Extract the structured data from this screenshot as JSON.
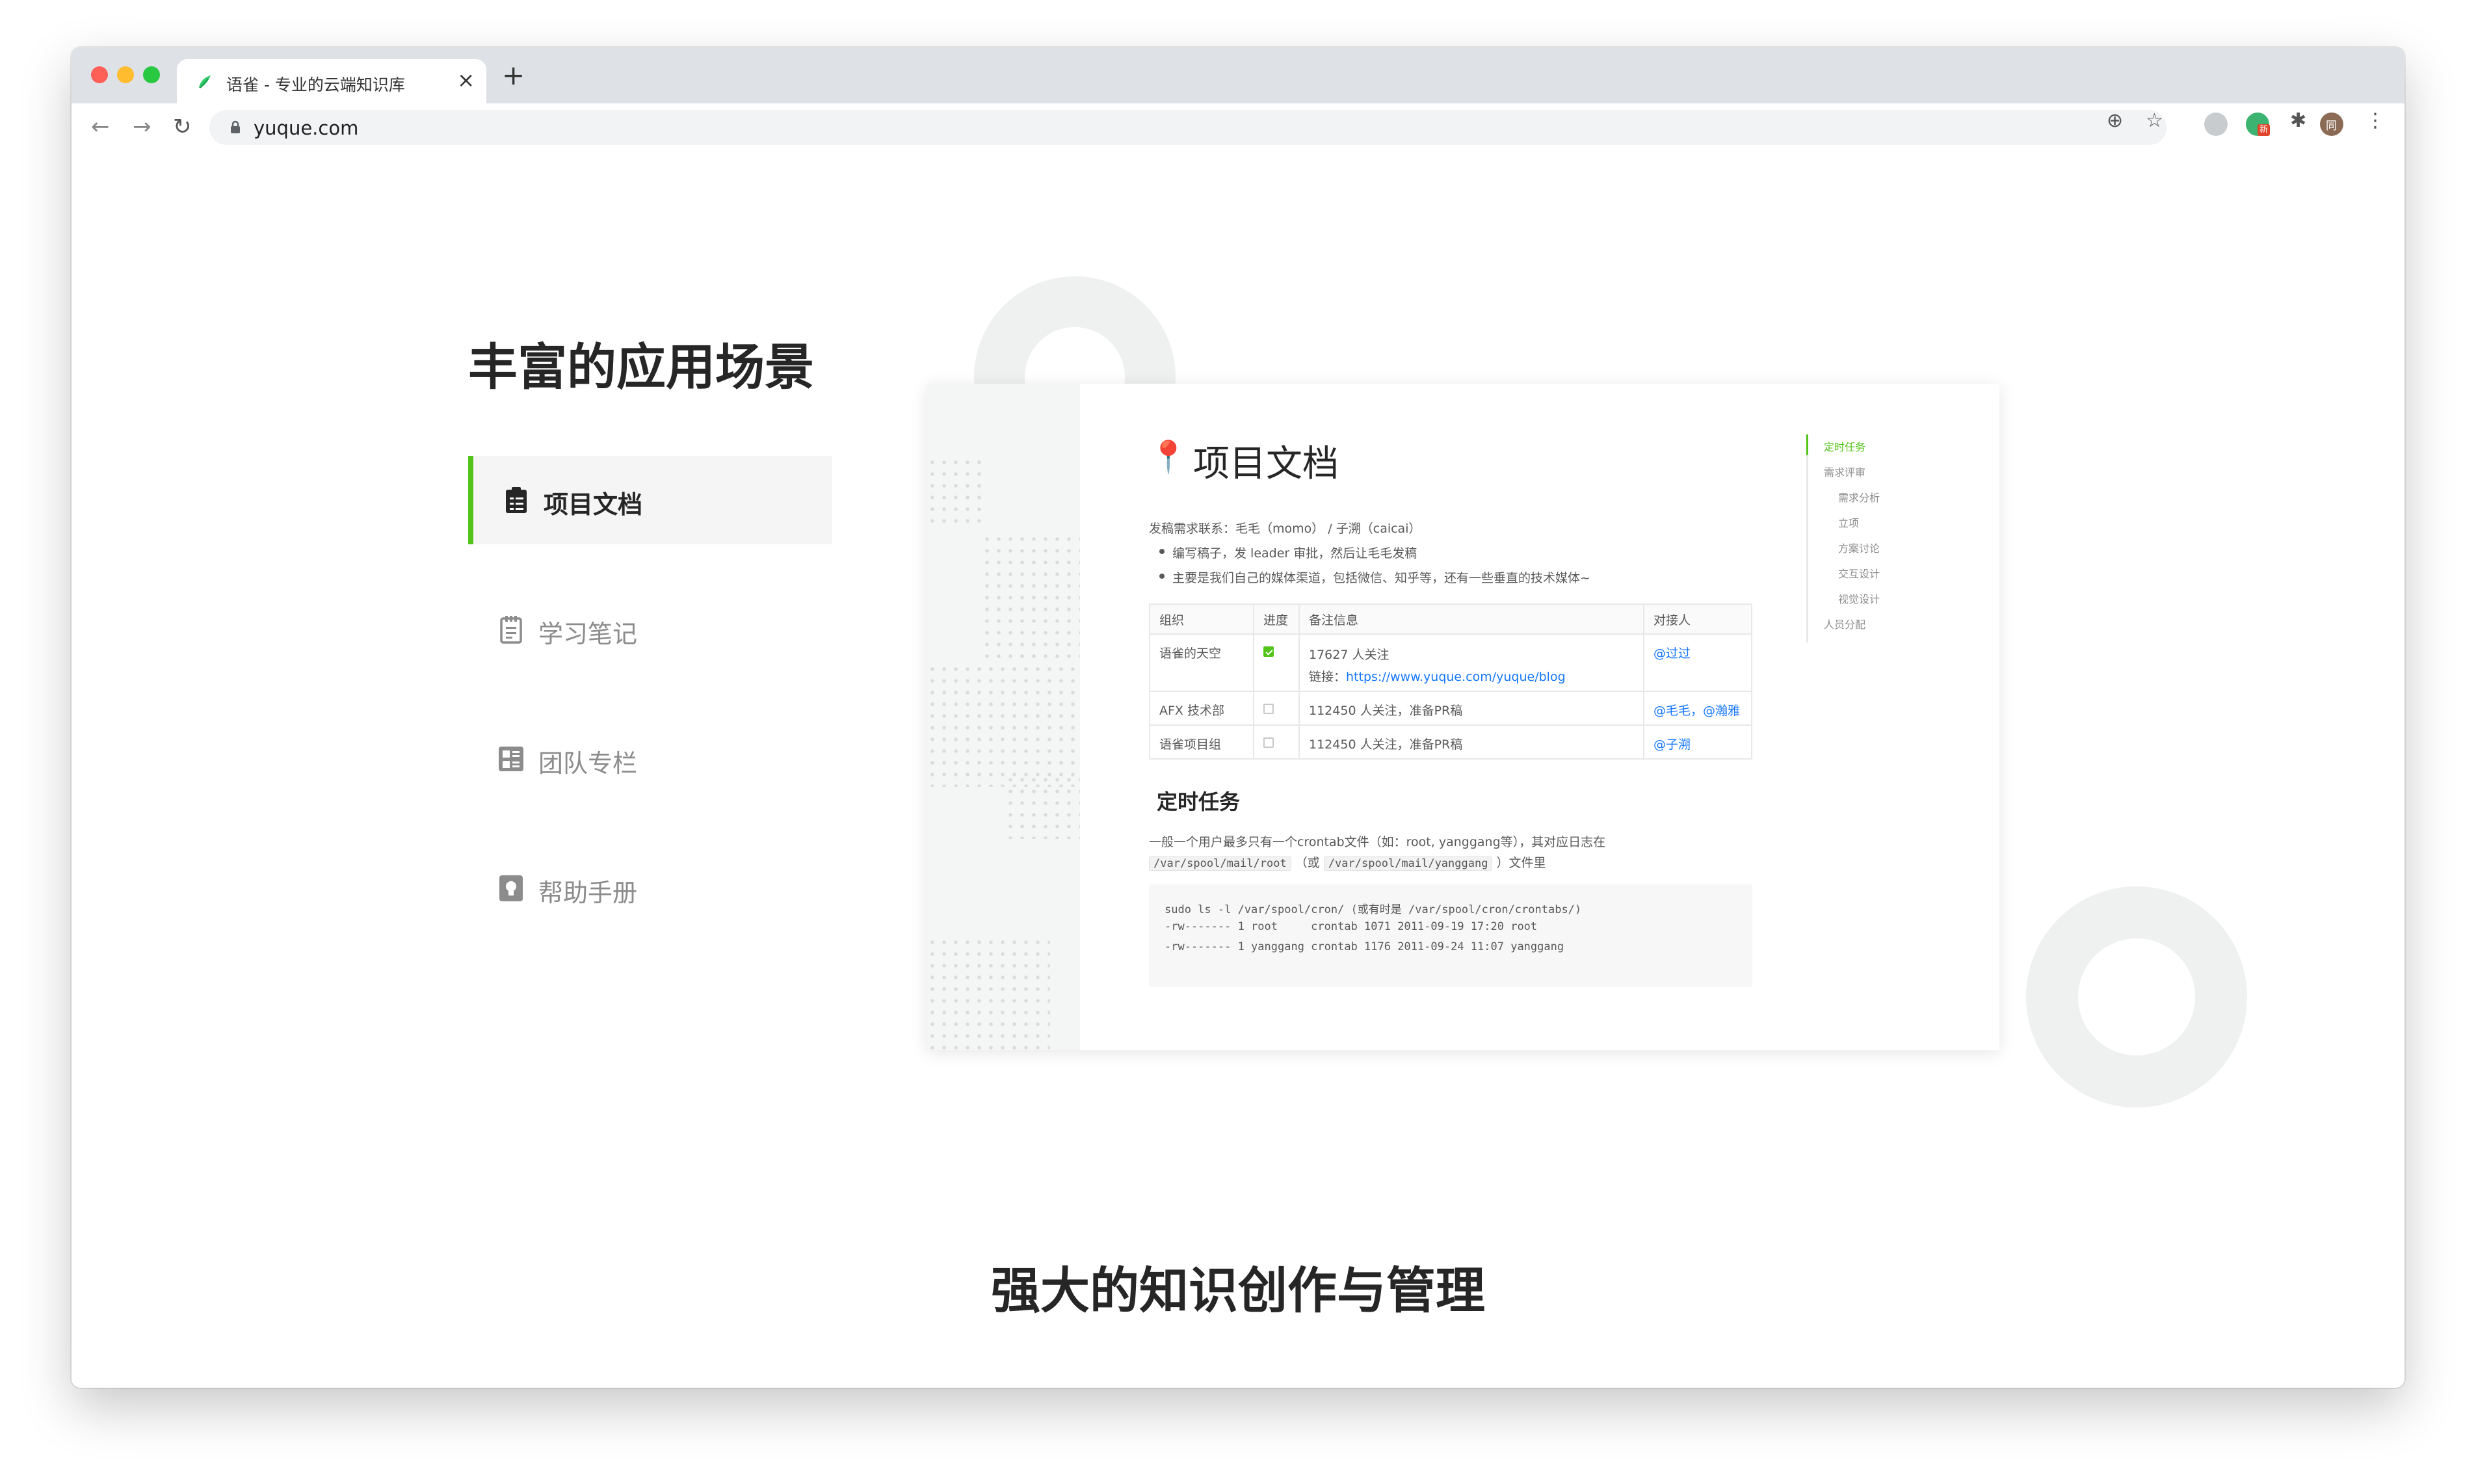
{
  "browser": {
    "tab_title": "语雀 - 专业的云端知识库",
    "tab_close": "×",
    "new_tab": "+",
    "url": "yuque.com",
    "profile_initial": "同",
    "ext_badge": "新"
  },
  "page": {
    "section_title": "丰富的应用场景",
    "menu": [
      {
        "label": "项目文档",
        "icon": "clipboard-icon",
        "active": true
      },
      {
        "label": "学习笔记",
        "icon": "notebook-icon",
        "active": false
      },
      {
        "label": "团队专栏",
        "icon": "layout-grid-icon",
        "active": false
      },
      {
        "label": "帮助手册",
        "icon": "lightbulb-icon",
        "active": false
      }
    ],
    "bottom_title": "强大的知识创作与管理"
  },
  "doc": {
    "emoji": "📍",
    "title": "项目文档",
    "contact_line": "发稿需求联系：毛毛（momo） / 子溯（caicai）",
    "bullets": [
      "编写稿子，发 leader 审批，然后让毛毛发稿",
      "主要是我们自己的媒体渠道，包括微信、知乎等，还有一些垂直的技术媒体~"
    ],
    "table": {
      "headers": [
        "组织",
        "进度",
        "备注信息",
        "对接人"
      ],
      "rows": [
        {
          "org": "语雀的天空",
          "done": true,
          "note": "17627 人关注",
          "link_label": "链接：",
          "link": "https://www.yuque.com/yuque/blog",
          "contact": "@过过"
        },
        {
          "org": "AFX 技术部",
          "done": false,
          "note": "112450 人关注，准备PR稿",
          "contact": "@毛毛，@瀚雅"
        },
        {
          "org": "语雀项目组",
          "done": false,
          "note": "112450 人关注，准备PR稿",
          "contact": "@子溯"
        }
      ]
    },
    "section2_title": "定时任务",
    "para1": "一般一个用户最多只有一个crontab文件（如：root, yanggang等），其对应日志在",
    "path1": "/var/spool/mail/root",
    "or_text": "（或",
    "path2": "/var/spool/mail/yanggang",
    "para_end": "）文件里",
    "code_lines": [
      "sudo ls -l /var/spool/cron/ (或有时是 /var/spool/cron/crontabs/)",
      "-rw------- 1 root     crontab 1071 2011-09-19 17:20 root",
      "-rw------- 1 yanggang crontab 1176 2011-09-24 11:07 yanggang"
    ],
    "toc": [
      {
        "label": "定时任务",
        "level": 0,
        "active": true
      },
      {
        "label": "需求评审",
        "level": 0,
        "active": false
      },
      {
        "label": "需求分析",
        "level": 1,
        "active": false
      },
      {
        "label": "立项",
        "level": 1,
        "active": false
      },
      {
        "label": "方案讨论",
        "level": 1,
        "active": false
      },
      {
        "label": "交互设计",
        "level": 1,
        "active": false
      },
      {
        "label": "视觉设计",
        "level": 1,
        "active": false
      },
      {
        "label": "人员分配",
        "level": 0,
        "active": false
      }
    ]
  },
  "colors": {
    "accent_green": "#52c41a",
    "link_blue": "#1677ff",
    "deco": "#eef1ef"
  }
}
